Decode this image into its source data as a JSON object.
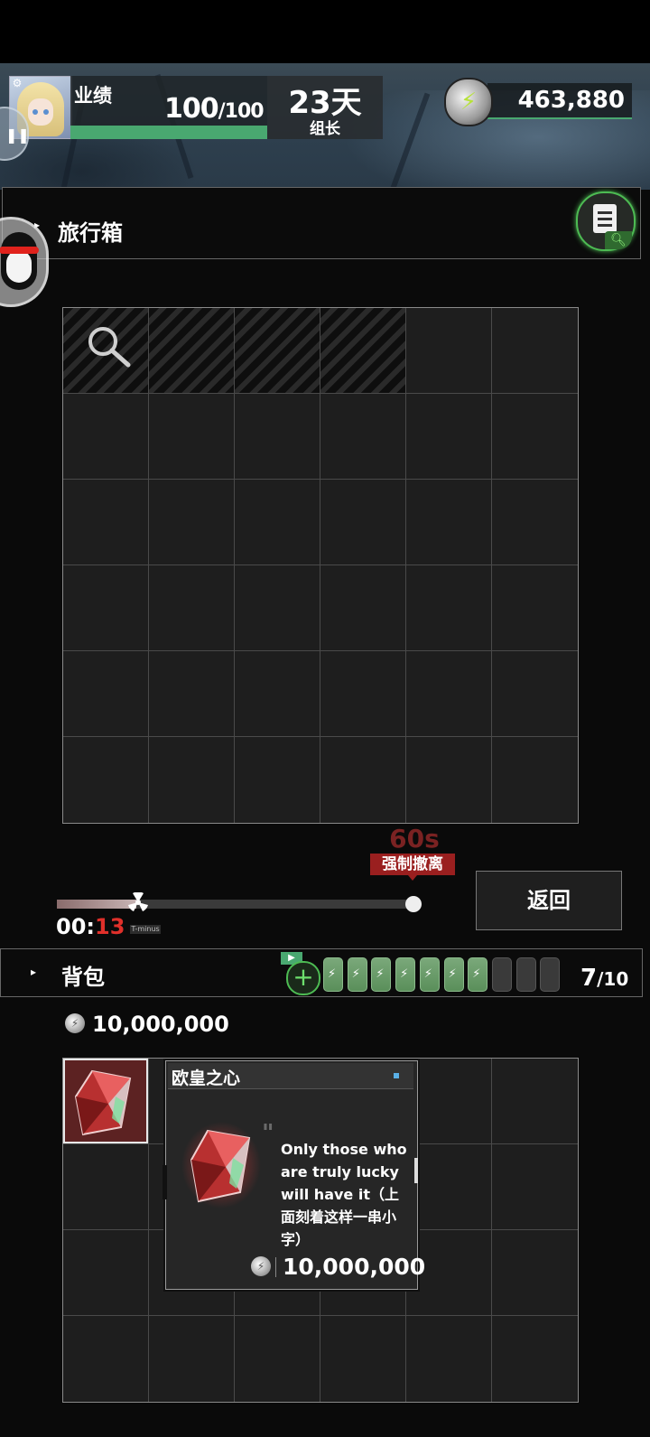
{
  "header": {
    "performance_label": "业绩",
    "performance_current": "100",
    "performance_max": "/100",
    "performance_fraction": 1.0,
    "days": "23天",
    "role": "组长",
    "currency_top": "463,880",
    "gear_symbol": "⚙",
    "bolt_symbol": "⚡"
  },
  "suitcase": {
    "title": "旅行箱",
    "arrow": "▸",
    "rows": 6,
    "cols": 6,
    "hatched_cells": 4,
    "search_icon": "magnifier-icon",
    "clipboard_icon": "clipboard-search-icon"
  },
  "timer": {
    "evac_seconds": "60s",
    "evac_label": "强制撤离",
    "elapsed_prefix": "00:",
    "elapsed_seconds": "13",
    "tminus_label": "T-minus",
    "progress_fraction": 0.22,
    "return_label": "返回"
  },
  "backpack": {
    "title": "背包",
    "arrow": "▸",
    "ad_symbol": "▶",
    "add_symbol": "+",
    "batteries_total": 10,
    "batteries_full": 7,
    "capacity_current": "7",
    "capacity_max": "/10",
    "money": "10,000,000",
    "rows": 4,
    "cols": 6
  },
  "tooltip": {
    "title": "欧皇之心",
    "quote": "\"",
    "description": "Only those who are truly lucky will have it（上面刻着这样一串小字）",
    "price": "10,000,000"
  },
  "colors": {
    "accent_green": "#49a870",
    "evac_red": "#9a1f1f",
    "timer_red": "#e0302a"
  }
}
